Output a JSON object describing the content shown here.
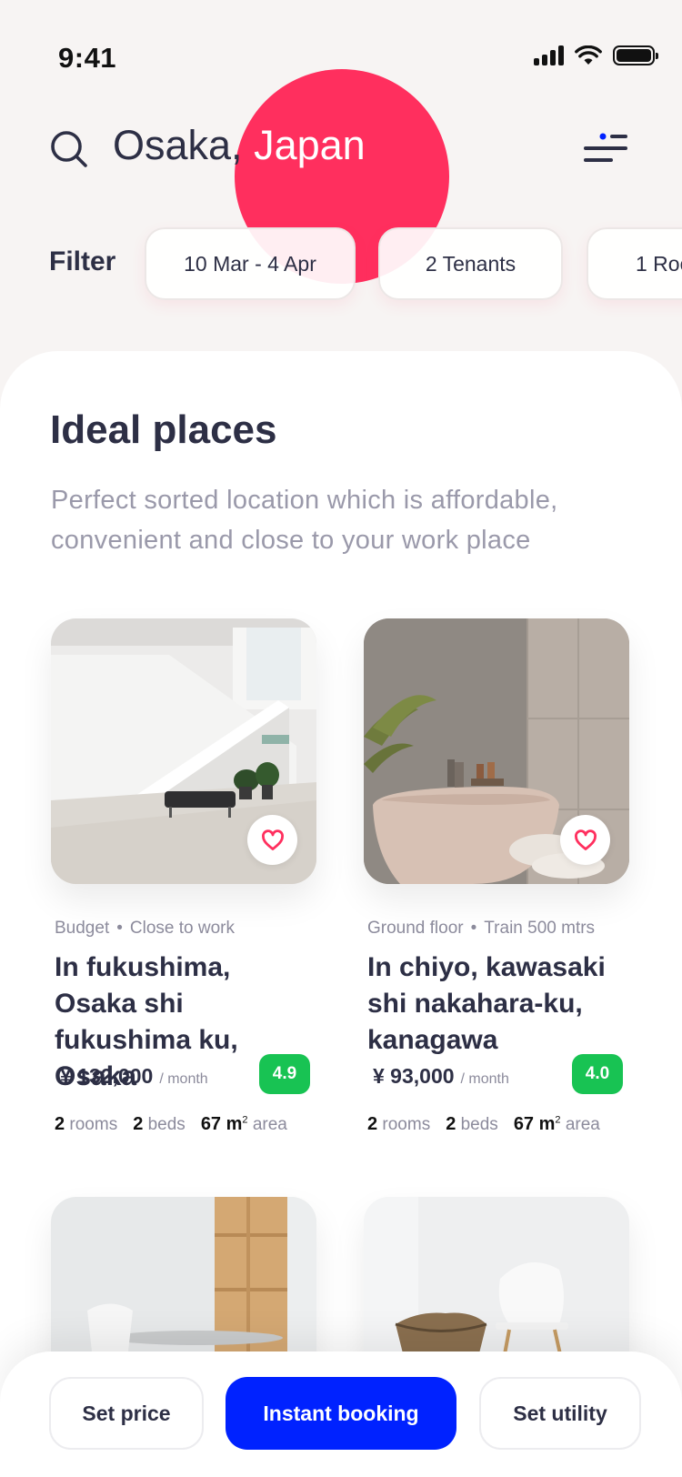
{
  "status_bar": {
    "time": "9:41"
  },
  "search": {
    "location_prefix": "Osaka,",
    "location_suffix": " Japan"
  },
  "filter": {
    "label": "Filter",
    "chips": [
      "10 Mar - 4 Apr",
      "2 Tenants",
      "1 Roo"
    ]
  },
  "section": {
    "title": "Ideal places",
    "description": "Perfect sorted location which is affordable, convenient and close to your work place"
  },
  "listings": [
    {
      "tags": [
        "Budget",
        "Close to work"
      ],
      "name": "In fukushima, Osaka shi fukushima ku, Osaka",
      "price": "¥ 132,000",
      "period": "/ month",
      "rating": "4.9",
      "rooms": "2",
      "rooms_label": "rooms",
      "beds": "2",
      "beds_label": "beds",
      "area": "67 m",
      "area_exp": "2",
      "area_label": "area"
    },
    {
      "tags": [
        "Ground floor",
        "Train 500 mtrs"
      ],
      "name": "In chiyo, kawasaki shi nakahara-ku, kanagawa",
      "price": "¥ 93,000",
      "period": "/ month",
      "rating": "4.0",
      "rooms": "2",
      "rooms_label": "rooms",
      "beds": "2",
      "beds_label": "beds",
      "area": "67 m",
      "area_exp": "2",
      "area_label": "area"
    }
  ],
  "bottom_actions": {
    "set_price": "Set price",
    "instant_booking": "Instant booking",
    "set_utility": "Set utility"
  },
  "colors": {
    "accent_pink": "#ff2f5e",
    "primary_blue": "#0022ff",
    "rating_green": "#18c353",
    "text_dark": "#2d2f45"
  },
  "icons": [
    "search-icon",
    "filter-menu-icon",
    "heart-icon",
    "signal-icon",
    "wifi-icon",
    "battery-icon"
  ]
}
